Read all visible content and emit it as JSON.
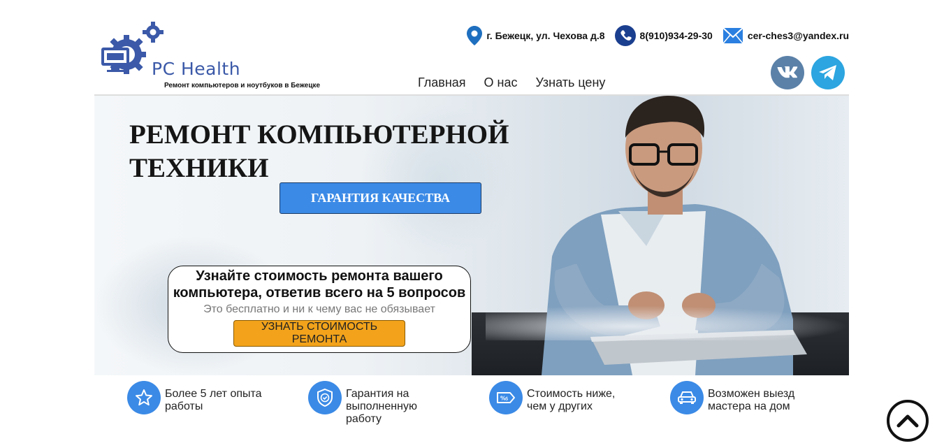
{
  "header": {
    "logo": {
      "title": "PC Health",
      "subtitle": "Ремонт компьютеров и ноутбуков в Бежецке",
      "icon": "gears-monitor-icon"
    },
    "contacts": [
      {
        "icon": "location-pin-icon",
        "text": "г. Бежецк, ул. Чехова д.8"
      },
      {
        "icon": "phone-icon",
        "text": "8(910)934-29-30"
      },
      {
        "icon": "mail-icon",
        "text": "cer-ches3@yandex.ru"
      }
    ],
    "nav": [
      {
        "label": "Главная"
      },
      {
        "label": "О нас"
      },
      {
        "label": "Узнать цену"
      }
    ],
    "socials": [
      {
        "icon": "vk-icon",
        "color": "#5b81a8"
      },
      {
        "icon": "telegram-icon",
        "color": "#2ca5e0"
      }
    ]
  },
  "hero": {
    "title_line1": "РЕМОНТ КОМПЬЮТЕРНОЙ",
    "title_line2": "ТЕХНИКИ",
    "guarantee_button": "ГАРАНТИЯ КАЧЕСТВА",
    "quiz": {
      "title": "Узнайте стоимость ремонта вашего компьютера, ответив всего на 5 вопросов",
      "subtitle": "Это бесплатно и ни к чему вас не обязывает",
      "button": "УЗНАТЬ СТОИМОСТЬ РЕМОНТА"
    }
  },
  "features": [
    {
      "icon": "star-icon",
      "text": "Более 5 лет опыта работы"
    },
    {
      "icon": "shield-check-icon",
      "text": "Гарантия на выполненную работу"
    },
    {
      "icon": "discount-tag-icon",
      "text": "Стоимость ниже, чем у других"
    },
    {
      "icon": "car-icon",
      "text": "Возможен выезд мастера на дом"
    }
  ],
  "colors": {
    "accent_blue": "#3b8ae6",
    "logo_blue": "#3b59a8",
    "cta_orange": "#f2a31b"
  },
  "scroll_top": {
    "icon": "chevron-up-icon"
  }
}
